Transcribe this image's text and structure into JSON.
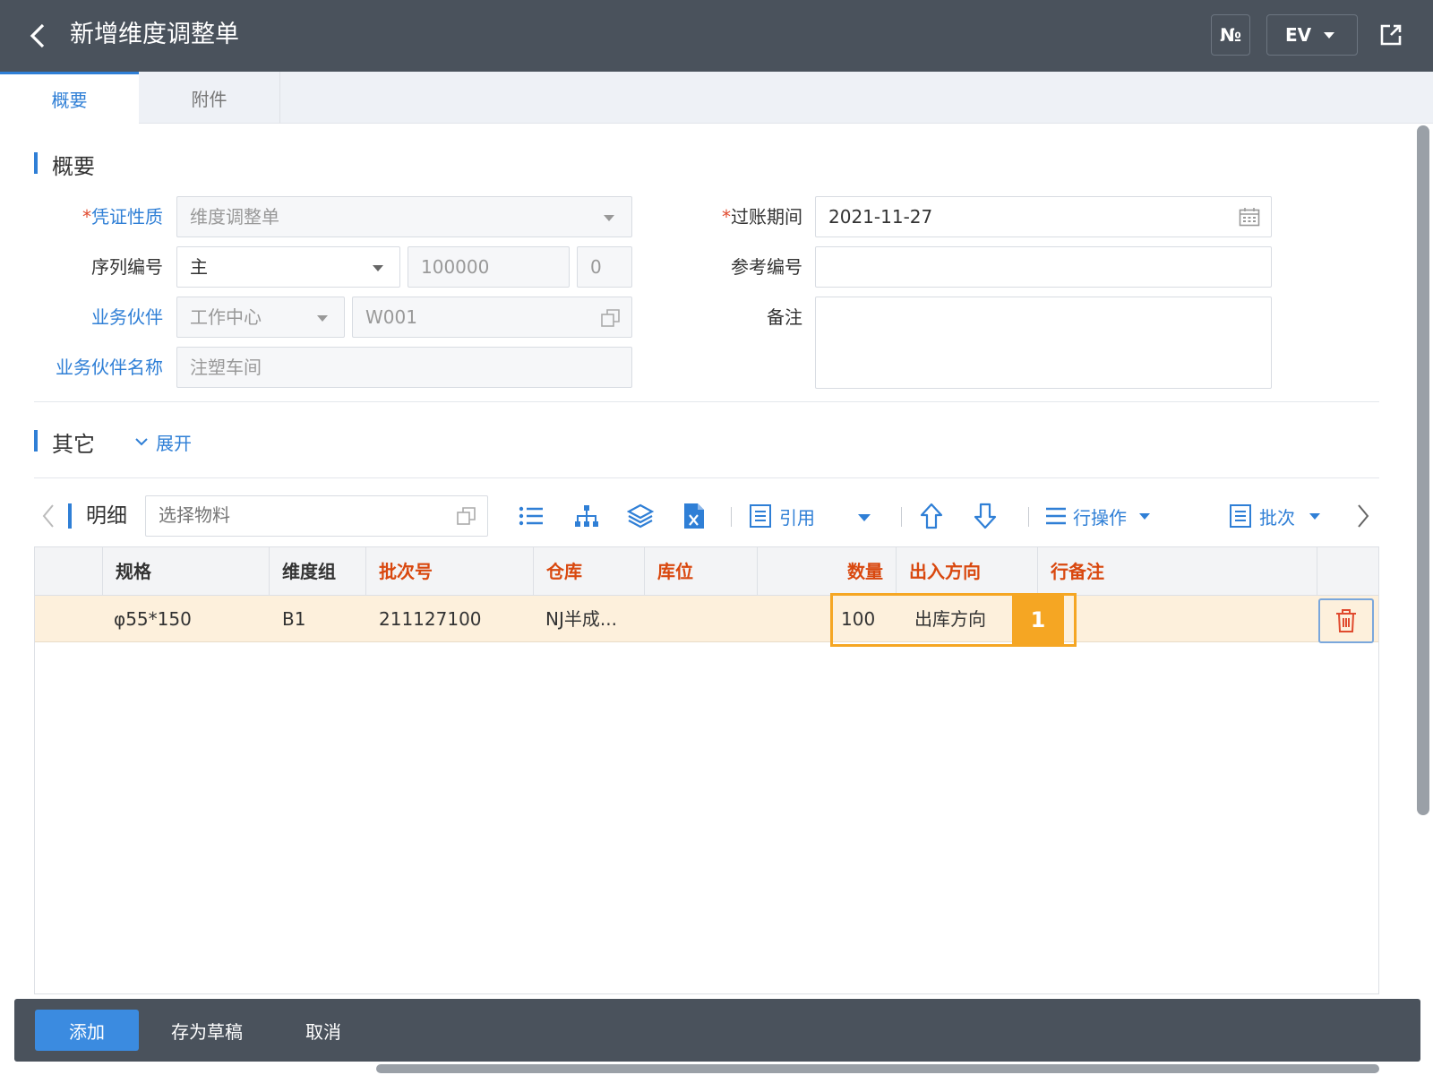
{
  "header": {
    "title": "新增维度调整单",
    "no_label": "№",
    "ev_label": "EV"
  },
  "tabs": [
    {
      "label": "概要"
    },
    {
      "label": "附件"
    }
  ],
  "summary": {
    "section_title": "概要",
    "voucher_type": {
      "label": "凭证性质",
      "value": "维度调整单"
    },
    "posting_period": {
      "label": "过账期间",
      "value": "2021-11-27"
    },
    "series": {
      "label": "序列编号",
      "value": "主",
      "number": "100000",
      "suffix": "0"
    },
    "reference": {
      "label": "参考编号",
      "value": ""
    },
    "partner": {
      "label": "业务伙伴",
      "type": "工作中心",
      "code": "W001"
    },
    "remark": {
      "label": "备注",
      "value": ""
    },
    "partner_name": {
      "label": "业务伙伴名称",
      "value": "注塑车间"
    }
  },
  "other": {
    "section_title": "其它",
    "expand_label": "展开"
  },
  "detail": {
    "title": "明细",
    "search_placeholder": "选择物料",
    "quote_label": "引用",
    "row_ops_label": "行操作",
    "batch_label": "批次",
    "columns": [
      "规格",
      "维度组",
      "批次号",
      "仓库",
      "库位",
      "数量",
      "出入方向",
      "行备注"
    ],
    "rows": [
      {
        "spec": "φ55*150",
        "dim_group": "B1",
        "batch_no": "211127100",
        "warehouse": "NJ半成...",
        "location": "",
        "qty": "100",
        "direction": "出库方向",
        "row_remark": ""
      }
    ]
  },
  "callout": {
    "number": "1"
  },
  "footer": {
    "add_label": "添加",
    "draft_label": "存为草稿",
    "cancel_label": "取消"
  },
  "colors": {
    "topbar": "#4a525c",
    "accent": "#2f7fd6",
    "highlight": "#f5a623",
    "row_bg": "#fdf0dc",
    "required_header": "#d9480f"
  }
}
